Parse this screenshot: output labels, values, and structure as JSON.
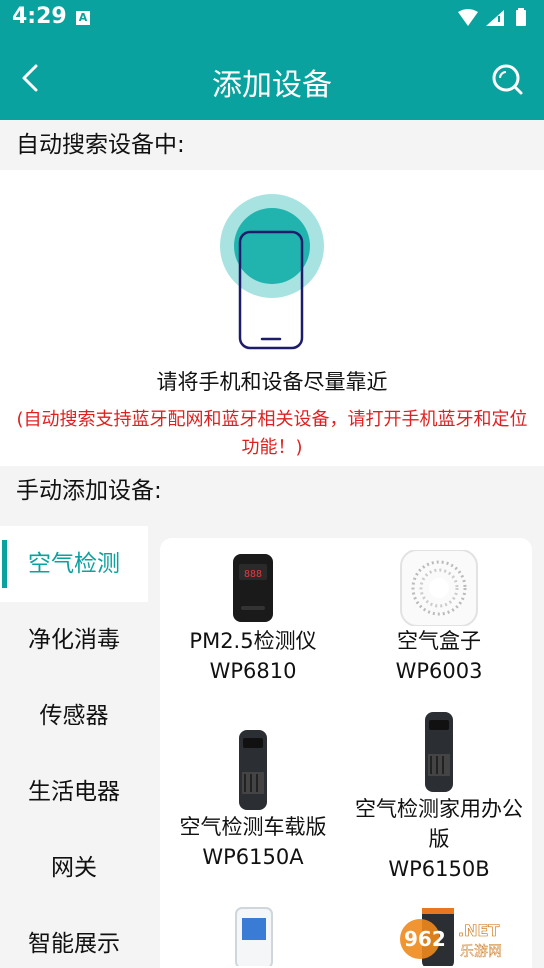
{
  "status": {
    "time": "4:29",
    "notif_letter": "A"
  },
  "appbar": {
    "title": "添加设备"
  },
  "auto": {
    "heading": "自动搜索设备中:",
    "hint": "请将手机和设备尽量靠近",
    "warning": "(自动搜索支持蓝牙配网和蓝牙相关设备，请打开手机蓝牙和定位功能！)"
  },
  "manual": {
    "heading": "手动添加设备:",
    "categories": [
      {
        "label": "空气检测",
        "active": true
      },
      {
        "label": "净化消毒",
        "active": false
      },
      {
        "label": "传感器",
        "active": false
      },
      {
        "label": "生活电器",
        "active": false
      },
      {
        "label": "网关",
        "active": false
      },
      {
        "label": "智能展示",
        "active": false
      }
    ],
    "devices": [
      {
        "name": "PM2.5检测仪",
        "model": "WP6810"
      },
      {
        "name": "空气盒子",
        "model": "WP6003"
      },
      {
        "name": "空气检测车载版",
        "model": "WP6150A"
      },
      {
        "name": "空气检测家用办公版",
        "model": "WP6150B"
      }
    ]
  },
  "watermark": {
    "brand": "962",
    "suffix": ".NET",
    "site": "乐游网"
  },
  "colors": {
    "accent": "#0aa29e",
    "warning": "#e02020"
  }
}
